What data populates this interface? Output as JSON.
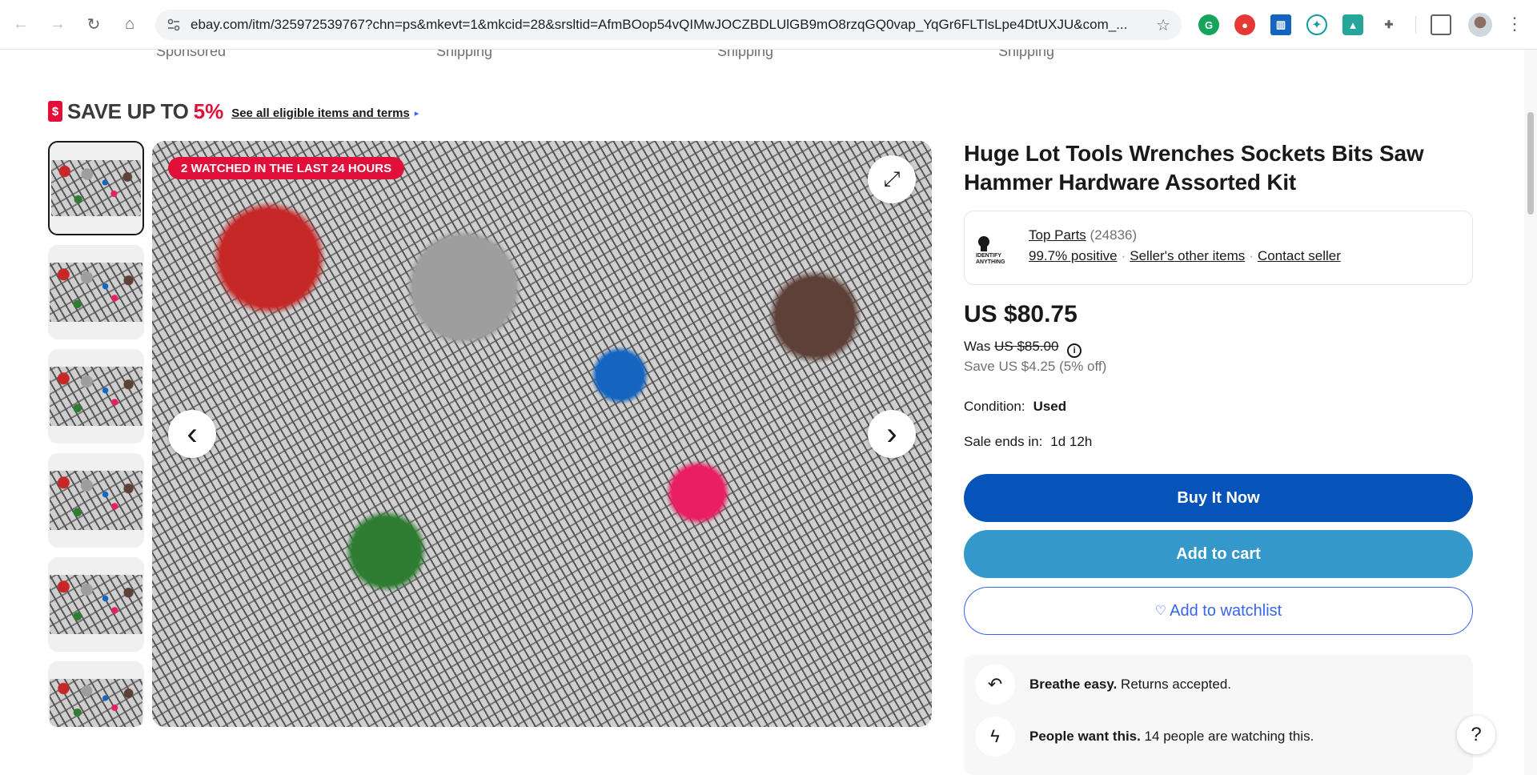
{
  "browser": {
    "url": "ebay.com/itm/325972539767?chn=ps&mkevt=1&mkcid=28&srsltid=AfmBOop54vQIMwJOCZBDLUlGB9mO8rzqGQ0vap_YqGr6FLTlsLpe4DtUXJU&com_...",
    "back_icon": "←",
    "forward_icon": "→",
    "reload_icon": "↻",
    "home_icon": "⌂",
    "star_icon": "☆",
    "menu_icon": "⋮"
  },
  "shipping_row": {
    "sponsored": "Sponsored",
    "shipping_1": "Shipping",
    "shipping_2": "Shipping",
    "shipping_3": "Shipping"
  },
  "banner": {
    "tag_glyph": "$",
    "save_text": "SAVE UP TO",
    "save_pct": "5%",
    "link_text": "See all eligible items and terms",
    "arrow": "▸"
  },
  "gallery": {
    "badge": "2 WATCHED IN THE LAST 24 HOURS",
    "thumbnail_count": 6,
    "expand_icon": "⤢",
    "prev_icon": "‹",
    "next_icon": "›"
  },
  "listing": {
    "title": "Huge Lot Tools Wrenches Sockets Bits Saw Hammer Hardware Assorted Kit",
    "seller_logo_text": "IDENTIFY ANYTHING",
    "seller_name": "Top Parts",
    "seller_count": "(24836)",
    "seller_positive": "99.7% positive",
    "seller_other": "Seller's other items",
    "contact_seller": "Contact seller",
    "price": "US $80.75",
    "was_label": "Was",
    "was_price": "US $85.00",
    "info_icon": "i",
    "save_line": "Save US $4.25 (5% off)",
    "condition_label": "Condition:",
    "condition_value": "Used",
    "sale_label": "Sale ends in:",
    "sale_value": "1d 12h"
  },
  "buttons": {
    "buy_now": "Buy It Now",
    "add_to_cart": "Add to cart",
    "watchlist": "Add to watchlist",
    "heart": "♡"
  },
  "assurance": {
    "returns_icon": "↶",
    "returns_bold": "Breathe easy.",
    "returns_text": "Returns accepted.",
    "demand_icon": "ϟ",
    "demand_bold": "People want this.",
    "demand_text": "14 people are watching this."
  },
  "help": {
    "icon": "?"
  },
  "colors": {
    "accent_red": "#e0103a",
    "buy_blue": "#0654ba",
    "cart_blue": "#3498ca",
    "link_blue": "#3665f3"
  }
}
